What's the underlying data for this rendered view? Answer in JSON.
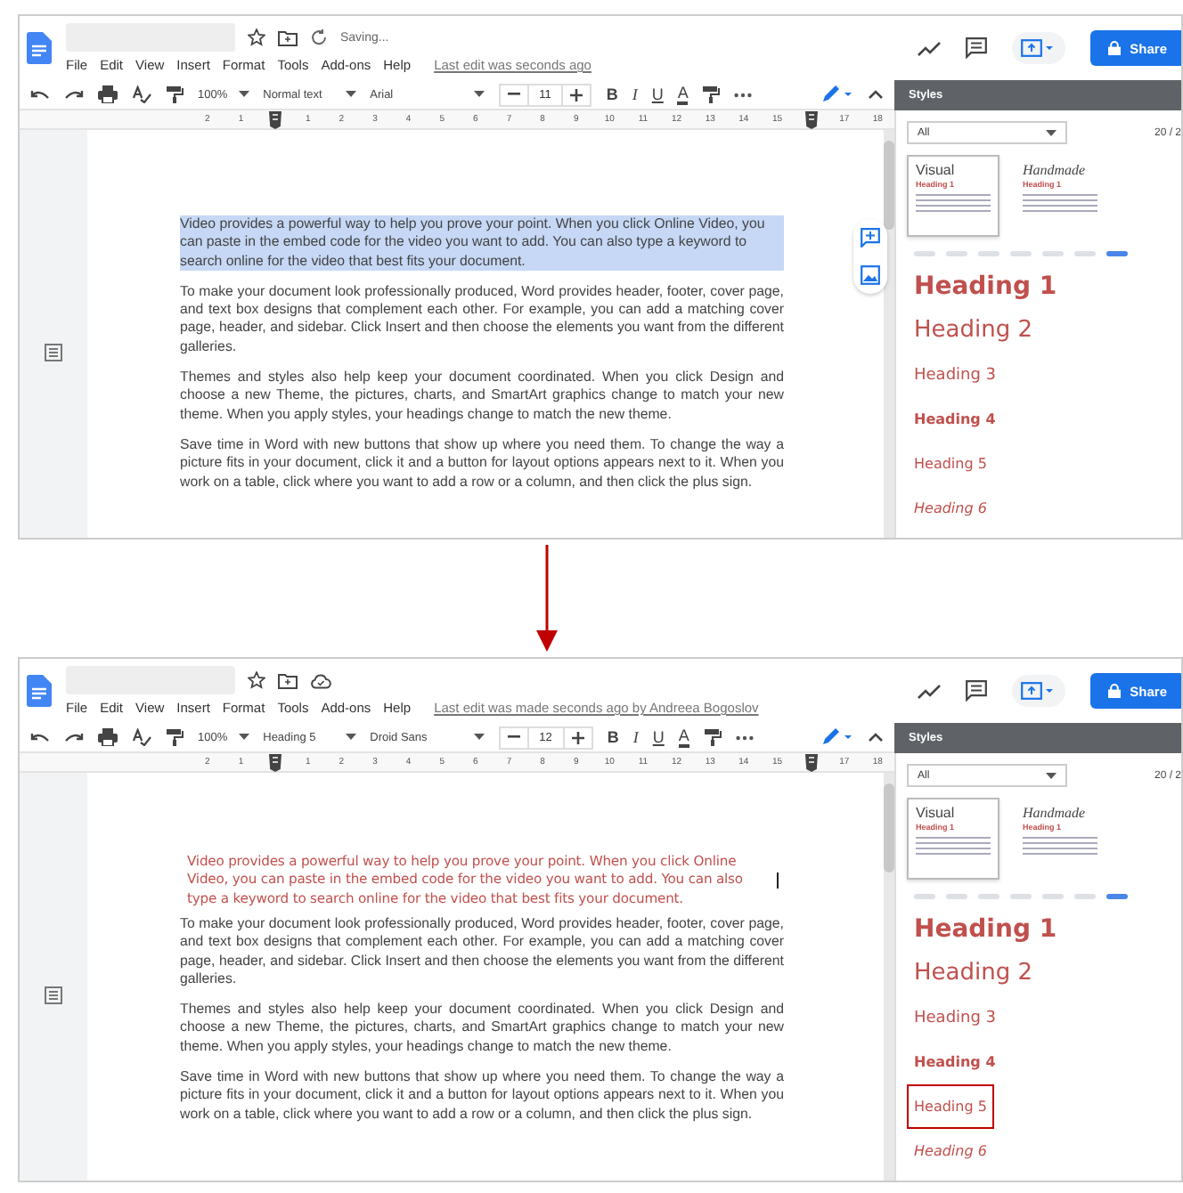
{
  "screens": [
    {
      "status": "Saving...",
      "menu": [
        "File",
        "Edit",
        "View",
        "Insert",
        "Format",
        "Tools",
        "Add-ons",
        "Help"
      ],
      "last_edit": "Last edit was seconds ago",
      "share": "Share",
      "toolbar": {
        "zoom": "100%",
        "style": "Normal text",
        "font": "Arial",
        "size": "11",
        "bold": "B",
        "italic": "I",
        "underline": "U",
        "text_color_label": "A"
      },
      "ruler": [
        "2",
        "1",
        "1",
        "2",
        "3",
        "4",
        "5",
        "6",
        "7",
        "8",
        "9",
        "10",
        "11",
        "12",
        "13",
        "14",
        "15",
        "17",
        "18"
      ],
      "floating_tools": true,
      "paragraphs": [
        {
          "kind": "body",
          "highlighted": true,
          "cursor": false,
          "text": "Video provides a powerful way to help you prove your point. When you click Online Video, you can paste in the embed code for the video you want to add. You can also type a keyword to search online for the video that best fits your document."
        },
        {
          "kind": "body",
          "highlighted": false,
          "cursor": false,
          "text": "To make your document look professionally produced, Word provides header, footer, cover page, and text box designs that complement each other. For example, you can add a matching cover page, header, and sidebar. Click Insert and then choose the elements you want from the different galleries."
        },
        {
          "kind": "body",
          "highlighted": false,
          "cursor": false,
          "text": "Themes and styles also help keep your document coordinated. When you click Design and choose a new Theme, the pictures, charts, and SmartArt graphics change to match your new theme. When you apply styles, your headings change to match the new theme."
        },
        {
          "kind": "body",
          "highlighted": false,
          "cursor": false,
          "text": "Save time in Word with new buttons that show up where you need them. To change the way a picture fits in your document, click it and a button for layout options appears next to it. When you work on a table, click where you want to add a row or a column, and then click the plus sign."
        }
      ],
      "styles_panel": {
        "title": "Styles",
        "filter": "All",
        "count": "20 / 2",
        "themes": [
          {
            "name": "Visual",
            "sample": "Heading 1",
            "selected": true
          },
          {
            "name": "Handmade",
            "sample": "Heading 1",
            "selected": false
          }
        ],
        "pages": [
          {
            "selected": false
          },
          {
            "selected": false
          },
          {
            "selected": false
          },
          {
            "selected": false
          },
          {
            "selected": false
          },
          {
            "selected": false
          },
          {
            "selected": true
          }
        ],
        "headings": [
          {
            "kind": "h1",
            "text": "Heading 1",
            "selected": false
          },
          {
            "kind": "h2",
            "text": "Heading 2",
            "selected": false
          },
          {
            "kind": "h3",
            "text": "Heading 3",
            "selected": false
          },
          {
            "kind": "h4",
            "text": "Heading 4",
            "selected": false
          },
          {
            "kind": "h5",
            "text": "Heading 5",
            "selected": false
          },
          {
            "kind": "h6",
            "text": "Heading 6",
            "selected": false
          }
        ]
      }
    },
    {
      "menu": [
        "File",
        "Edit",
        "View",
        "Insert",
        "Format",
        "Tools",
        "Add-ons",
        "Help"
      ],
      "last_edit": "Last edit was made seconds ago by Andreea Bogoslov",
      "share": "Share",
      "toolbar": {
        "zoom": "100%",
        "style": "Heading 5",
        "font": "Droid Sans",
        "size": "12",
        "bold": "B",
        "italic": "I",
        "underline": "U",
        "text_color_label": "A"
      },
      "ruler": [
        "2",
        "1",
        "1",
        "2",
        "3",
        "4",
        "5",
        "6",
        "7",
        "8",
        "9",
        "10",
        "11",
        "12",
        "13",
        "14",
        "15",
        "17",
        "18"
      ],
      "floating_tools": false,
      "paragraphs": [
        {
          "kind": "heading",
          "highlighted": false,
          "cursor": true,
          "text": "Video provides a powerful way to help you prove your point. When you click Online Video, you can paste in the embed code for the video you want to add. You can also type a keyword to search online for the video that best fits your document."
        },
        {
          "kind": "body",
          "highlighted": false,
          "cursor": false,
          "text": "To make your document look professionally produced, Word provides header, footer, cover page, and text box designs that complement each other. For example, you can add a matching cover page, header, and sidebar. Click Insert and then choose the elements you want from the different galleries."
        },
        {
          "kind": "body",
          "highlighted": false,
          "cursor": false,
          "text": "Themes and styles also help keep your document coordinated. When you click Design and choose a new Theme, the pictures, charts, and SmartArt graphics change to match your new theme. When you apply styles, your headings change to match the new theme."
        },
        {
          "kind": "body",
          "highlighted": false,
          "cursor": false,
          "text": "Save time in Word with new buttons that show up where you need them. To change the way a picture fits in your document, click it and a button for layout options appears next to it. When you work on a table, click where you want to add a row or a column, and then click the plus sign."
        }
      ],
      "styles_panel": {
        "title": "Styles",
        "filter": "All",
        "count": "20 / 2",
        "themes": [
          {
            "name": "Visual",
            "sample": "Heading 1",
            "selected": true
          },
          {
            "name": "Handmade",
            "sample": "Heading 1",
            "selected": false
          }
        ],
        "pages": [
          {
            "selected": false
          },
          {
            "selected": false
          },
          {
            "selected": false
          },
          {
            "selected": false
          },
          {
            "selected": false
          },
          {
            "selected": false
          },
          {
            "selected": true
          }
        ],
        "headings": [
          {
            "kind": "h1",
            "text": "Heading 1",
            "selected": false
          },
          {
            "kind": "h2",
            "text": "Heading 2",
            "selected": false
          },
          {
            "kind": "h3",
            "text": "Heading 3",
            "selected": false
          },
          {
            "kind": "h4",
            "text": "Heading 4",
            "selected": false
          },
          {
            "kind": "h5",
            "text": "Heading 5",
            "selected": true
          },
          {
            "kind": "h6",
            "text": "Heading 6",
            "selected": false
          }
        ]
      }
    }
  ]
}
